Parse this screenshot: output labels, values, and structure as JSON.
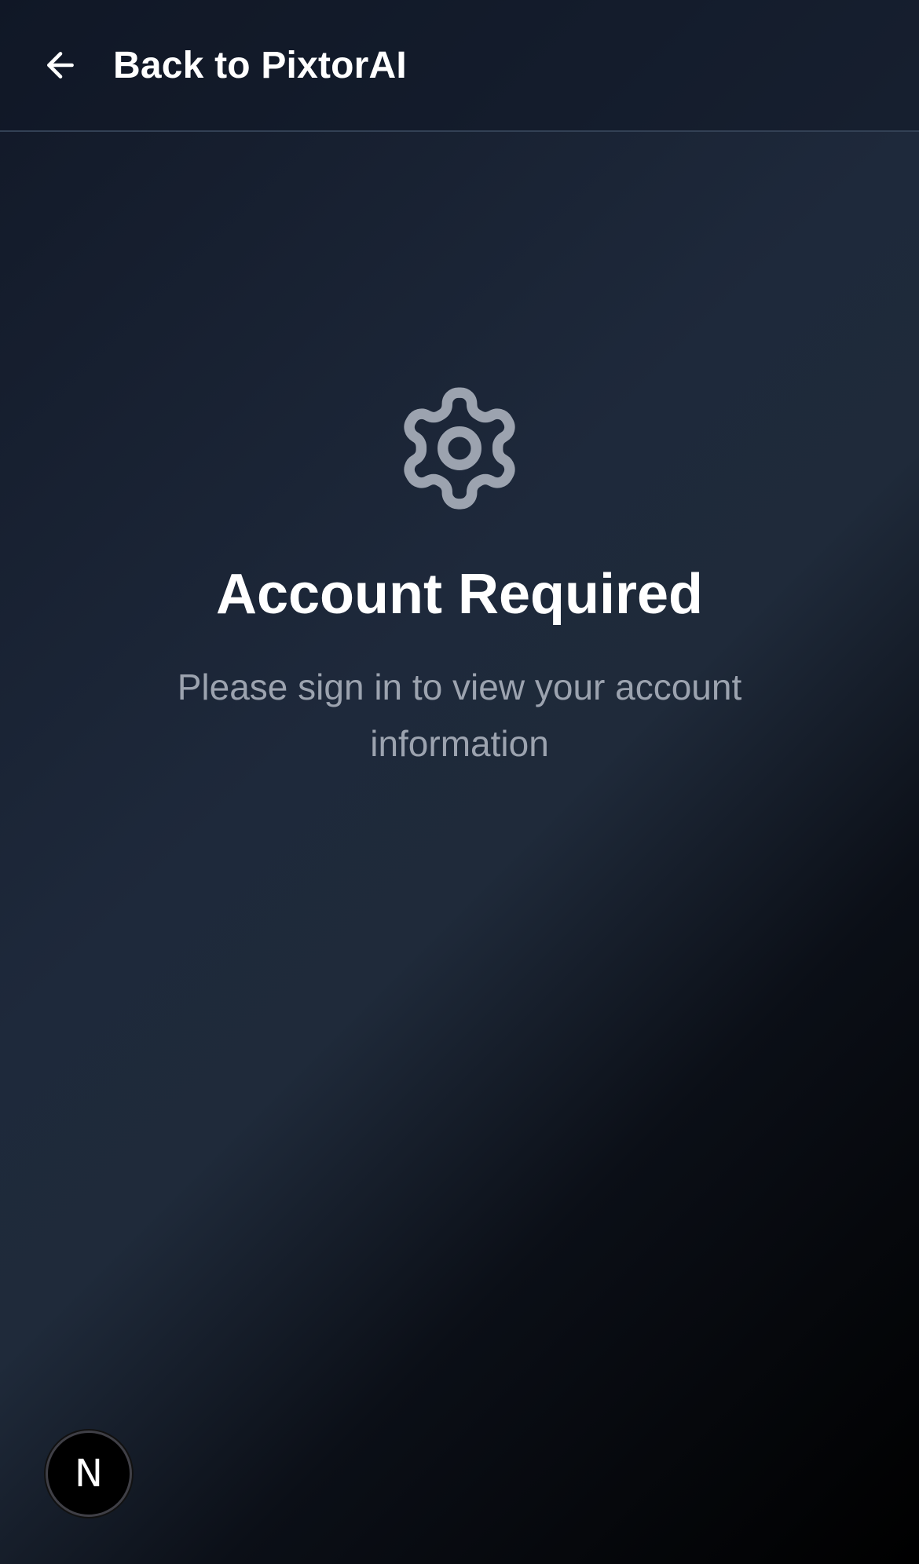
{
  "header": {
    "back_label": "Back to PixtorAI",
    "back_icon": "arrow-left-icon"
  },
  "main": {
    "icon": "gear-icon",
    "title": "Account Required",
    "subtitle": "Please sign in to view your account information"
  },
  "badge": {
    "letter": "N",
    "icon": "nextjs-logo-icon"
  },
  "colors": {
    "text_primary": "#ffffff",
    "text_secondary": "#9ca3af",
    "gear": "#9ca3af",
    "divider": "#334155"
  }
}
